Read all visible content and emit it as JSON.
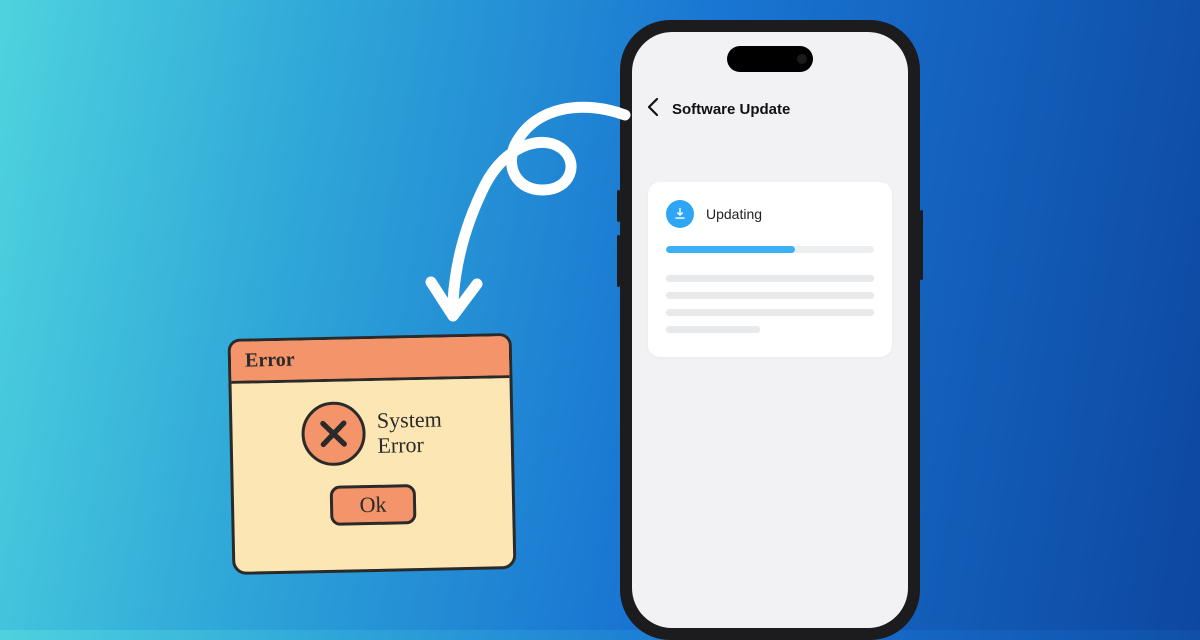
{
  "phone": {
    "nav_title": "Software Update",
    "card_label": "Updating",
    "progress_percent": 62
  },
  "error_dialog": {
    "title": "Error",
    "message_line1": "System",
    "message_line2": "Error",
    "ok_label": "Ok"
  },
  "colors": {
    "gradient_start": "#4ED3DE",
    "gradient_end": "#0D47A1",
    "accent_blue": "#3BB0F6",
    "error_bg": "#FCE6B4",
    "error_accent": "#F4946A",
    "ink": "#2a2a2a"
  }
}
